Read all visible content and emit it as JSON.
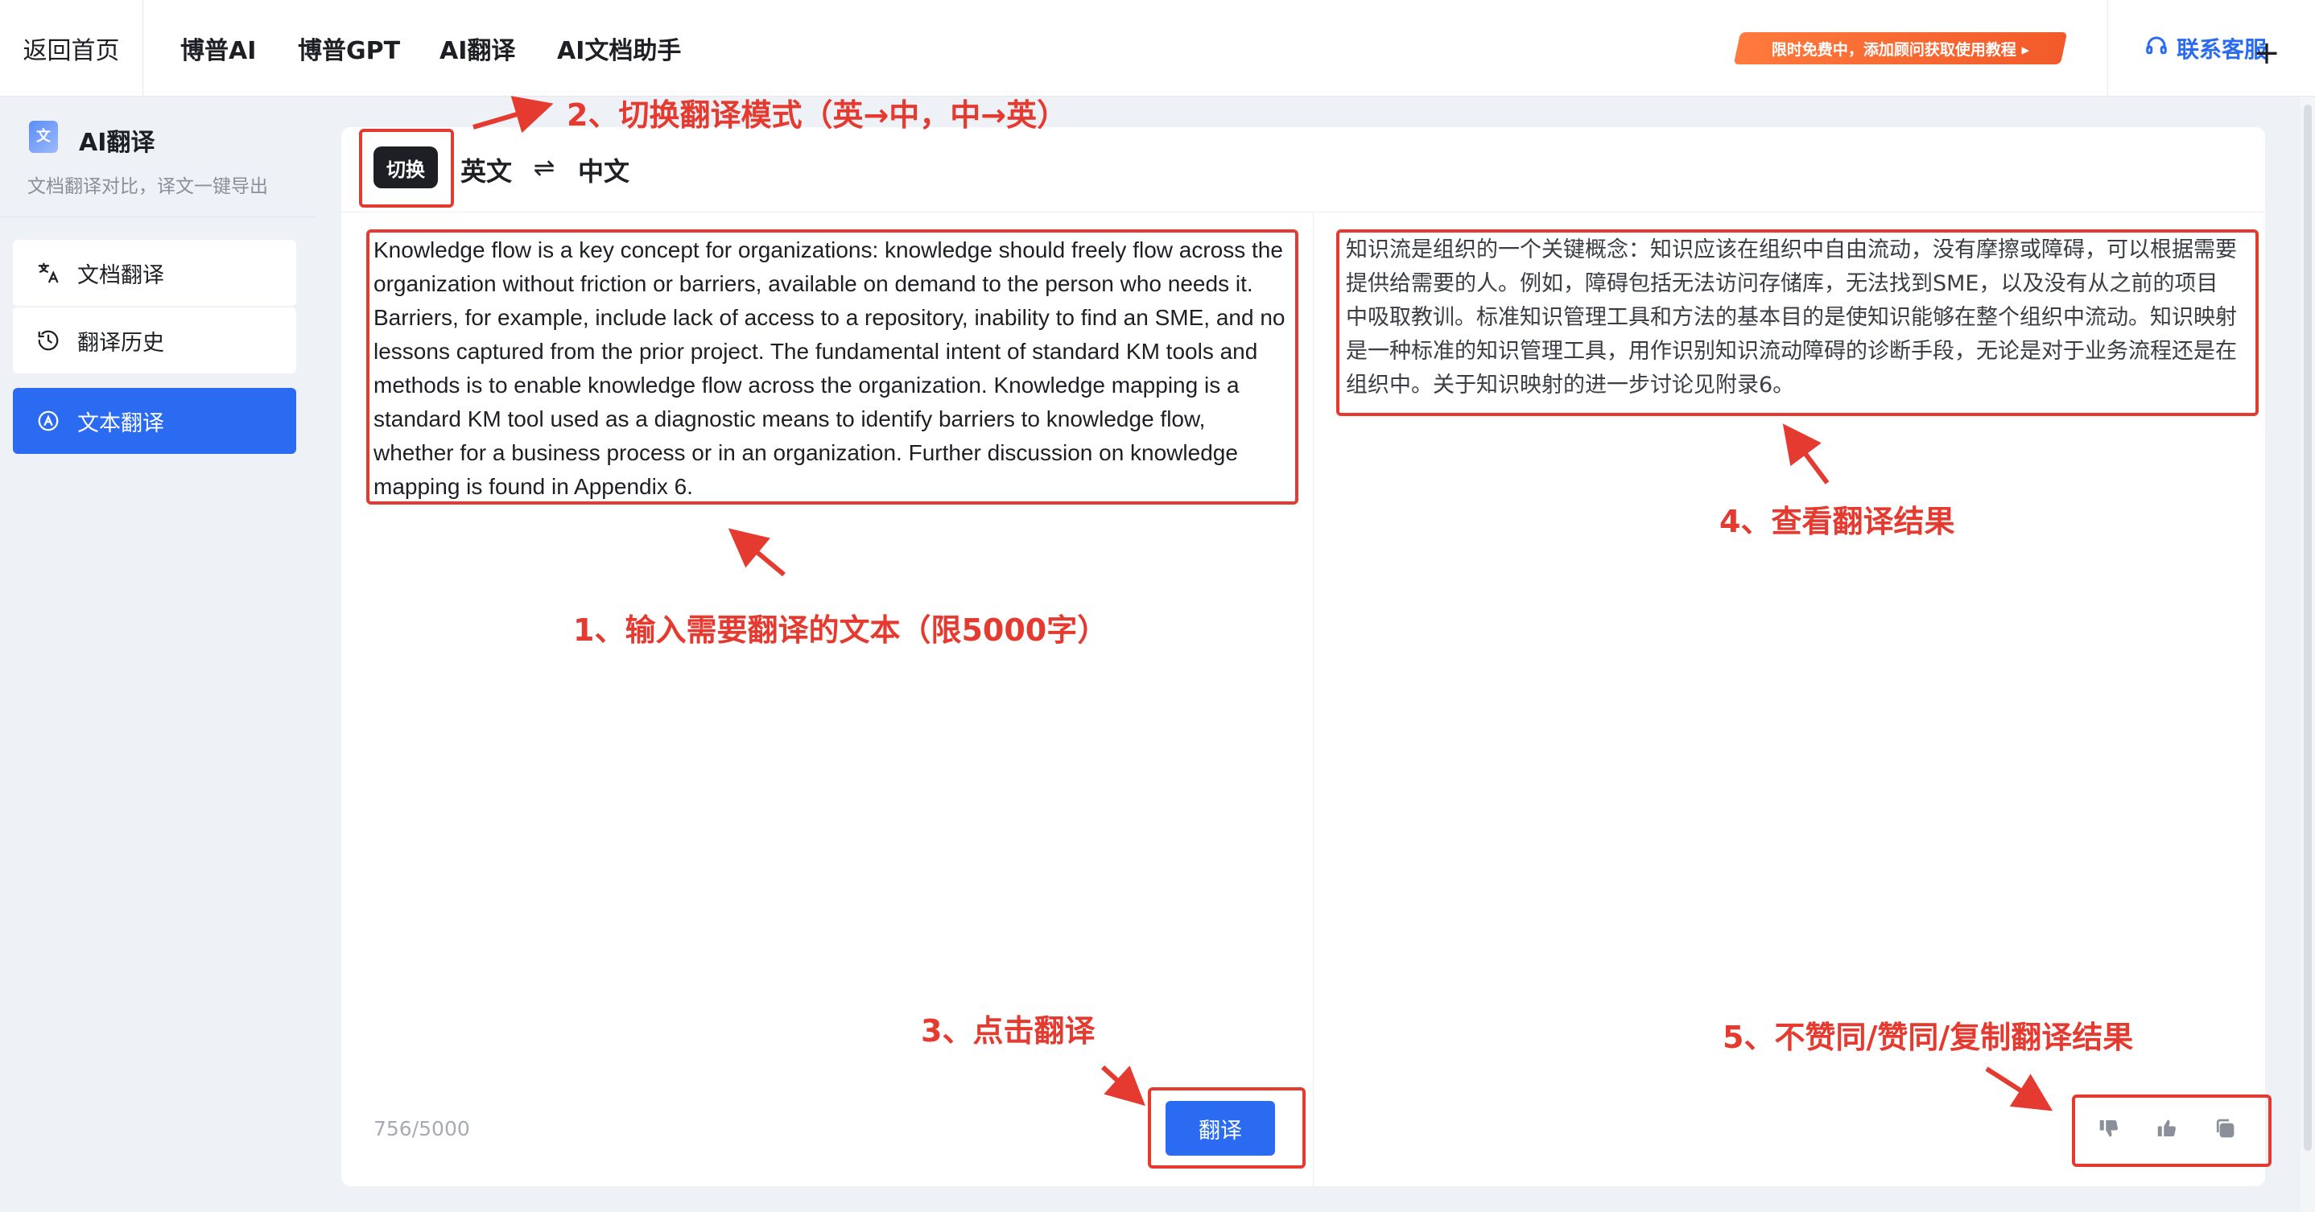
{
  "topbar": {
    "home": "返回首页",
    "nav": [
      "博普AI",
      "博普GPT",
      "AI翻译",
      "AI文档助手"
    ],
    "promo": "限时免费中，添加顾问获取使用教程 ▸",
    "support": "联系客服"
  },
  "sidebar": {
    "title": "AI翻译",
    "subtitle": "文档翻译对比，译文一键导出",
    "items": [
      {
        "label": "文档翻译",
        "icon": "translate-icon"
      },
      {
        "label": "翻译历史",
        "icon": "history-icon"
      },
      {
        "label": "文本翻译",
        "icon": "text-translate-icon",
        "active": true
      }
    ]
  },
  "toolbar": {
    "switch_label": "切换",
    "source_lang": "英文",
    "target_lang": "中文",
    "swap_symbol": "⇌"
  },
  "source": {
    "text": "Knowledge flow is a key concept for organizations: knowledge should freely flow across the organization without friction or barriers, available on demand to the person who needs it. Barriers, for example, include lack of access to a repository, inability to find an SME, and no lessons captured from the prior project. The fundamental intent of standard KM tools and methods is to enable knowledge flow across the organization. Knowledge mapping is a standard KM tool used as a diagnostic means to identify barriers to knowledge flow, whether for a business process or in an organization. Further discussion on knowledge mapping is found in Appendix 6.",
    "counter": "756/5000",
    "translate_label": "翻译"
  },
  "target": {
    "text": "知识流是组织的一个关键概念：知识应该在组织中自由流动，没有摩擦或障碍，可以根据需要提供给需要的人。例如，障碍包括无法访问存储库，无法找到SME，以及没有从之前的项目中吸取教训。标准知识管理工具和方法的基本目的是使知识能够在整个组织中流动。知识映射是一种标准的知识管理工具，用作识别知识流动障碍的诊断手段，无论是对于业务流程还是在组织中。关于知识映射的进一步讨论见附录6。"
  },
  "annotations": {
    "a1": "1、输入需要翻译的文本（限5000字）",
    "a2": "2、切换翻译模式（英→中，中→英）",
    "a3": "3、点击翻译",
    "a4": "4、查看翻译结果",
    "a5": "5、不赞同/赞同/复制翻译结果"
  },
  "colors": {
    "accent": "#2a6bf2",
    "annotation": "#e53a30",
    "promo": "#f25a2a"
  }
}
